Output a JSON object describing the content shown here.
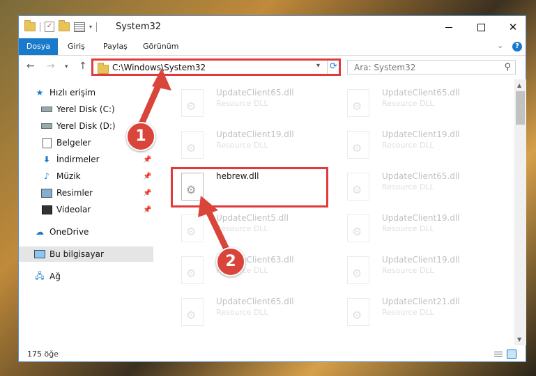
{
  "window": {
    "title": "System32",
    "ribbon_tabs": [
      "Dosya",
      "Giriş",
      "Paylaş",
      "Görünüm"
    ],
    "help_label": "?"
  },
  "address": {
    "path": "C:\\Windows\\System32",
    "search_placeholder": "Ara: System32"
  },
  "sidebar": {
    "items": [
      {
        "label": "Hızlı erişim",
        "icon": "star-icon",
        "pinned": false
      },
      {
        "label": "Yerel Disk (C:)",
        "icon": "drive-icon",
        "pinned": false
      },
      {
        "label": "Yerel Disk (D:)",
        "icon": "drive-icon",
        "pinned": false
      },
      {
        "label": "Belgeler",
        "icon": "documents-icon",
        "pinned": true
      },
      {
        "label": "İndirmeler",
        "icon": "download-icon",
        "pinned": true
      },
      {
        "label": "Müzik",
        "icon": "music-icon",
        "pinned": true
      },
      {
        "label": "Resimler",
        "icon": "pictures-icon",
        "pinned": true
      },
      {
        "label": "Videolar",
        "icon": "videos-icon",
        "pinned": true
      },
      {
        "label": "OneDrive",
        "icon": "cloud-icon",
        "pinned": false
      },
      {
        "label": "Bu bilgisayar",
        "icon": "computer-icon",
        "pinned": false,
        "selected": true
      },
      {
        "label": "Ağ",
        "icon": "network-icon",
        "pinned": false
      }
    ]
  },
  "files": {
    "left": [
      {
        "name": "UpdateClient65.dll",
        "type": "Resource DLL",
        "faded": true
      },
      {
        "name": "UpdateClient19.dll",
        "type": "Resource DLL",
        "faded": true
      },
      {
        "name": "hebrew.dll",
        "type": "",
        "faded": false,
        "highlighted": true
      },
      {
        "name": "UpdateClient5.dll",
        "type": "Resource DLL",
        "faded": true
      },
      {
        "name": "UpdateClient63.dll",
        "type": "Resource DLL",
        "faded": true
      },
      {
        "name": "UpdateClient65.dll",
        "type": "Resource DLL",
        "faded": true
      }
    ],
    "right": [
      {
        "name": "UpdateClient65.dll",
        "type": "Resource DLL",
        "faded": true
      },
      {
        "name": "UpdateClient19.dll",
        "type": "Resource DLL",
        "faded": true
      },
      {
        "name": "UpdateClient65.dll",
        "type": "Resource DLL",
        "faded": true
      },
      {
        "name": "UpdateClient19.dll",
        "type": "Resource DLL",
        "faded": true
      },
      {
        "name": "UpdateClient19.dll",
        "type": "Resource DLL",
        "faded": true
      },
      {
        "name": "UpdateClient21.dll",
        "type": "Resource DLL",
        "faded": true
      }
    ]
  },
  "status": {
    "item_count": "175 öğe"
  },
  "annotations": {
    "step1": "1",
    "step2": "2",
    "color": "#d9453a"
  }
}
